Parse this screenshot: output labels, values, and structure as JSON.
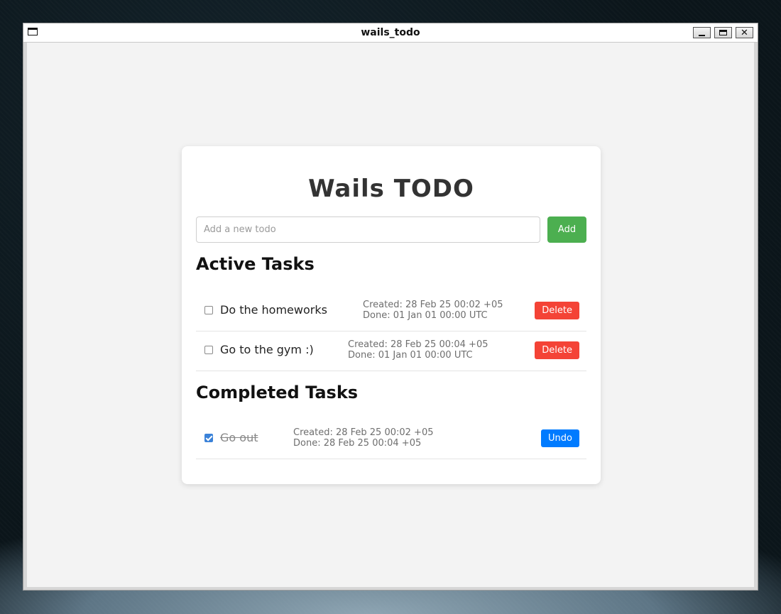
{
  "window": {
    "title": "wails_todo"
  },
  "app": {
    "title": "Wails TODO",
    "input": {
      "placeholder": "Add a new todo",
      "value": ""
    },
    "add_label": "Add"
  },
  "active": {
    "heading": "Active Tasks",
    "tasks": [
      {
        "text": "Do the homeworks",
        "created": "Created: 28 Feb 25 00:02 +05",
        "done": "Done: 01 Jan 01 00:00 UTC",
        "action": "Delete",
        "checked": false
      },
      {
        "text": "Go to the gym :)",
        "created": "Created: 28 Feb 25 00:04 +05",
        "done": "Done: 01 Jan 01 00:00 UTC",
        "action": "Delete",
        "checked": false
      }
    ]
  },
  "completed": {
    "heading": "Completed Tasks",
    "tasks": [
      {
        "text": "Go out",
        "created": "Created: 28 Feb 25 00:02 +05",
        "done": "Done: 28 Feb 25 00:04 +05",
        "action": "Undo",
        "checked": true
      }
    ]
  },
  "colors": {
    "add_button": "#4caf50",
    "delete_button": "#f44336",
    "undo_button": "#007bff",
    "checkbox_checked": "#3b82d8"
  },
  "icons": {
    "window_menu": "window-menu-icon",
    "minimize": "minimize-icon",
    "maximize": "maximize-icon",
    "close": "close-icon",
    "checkbox": "checkbox-icon",
    "checkbox_checked": "checkbox-checked-icon"
  }
}
